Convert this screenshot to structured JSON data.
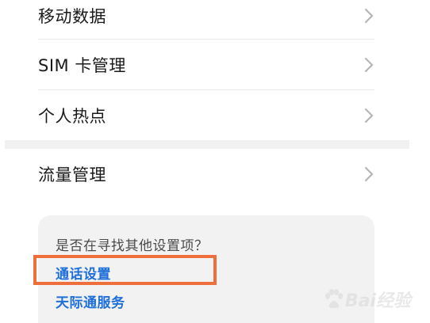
{
  "menu": {
    "items": [
      {
        "label": "移动数据"
      },
      {
        "label": "SIM 卡管理"
      },
      {
        "label": "个人热点"
      },
      {
        "label": "流量管理"
      }
    ]
  },
  "suggestions": {
    "heading": "是否在寻找其他设置项？",
    "links": [
      {
        "label": "通话设置"
      },
      {
        "label": "天际通服务"
      }
    ]
  },
  "highlight": {
    "target": "通话设置",
    "color": "#ee6e3c"
  },
  "watermark": {
    "text": "Bai经验"
  },
  "colors": {
    "link": "#1e6fd9",
    "text": "#1a1a1a",
    "chevron": "#b3b3b3",
    "card_background": "#f2f2f2"
  }
}
